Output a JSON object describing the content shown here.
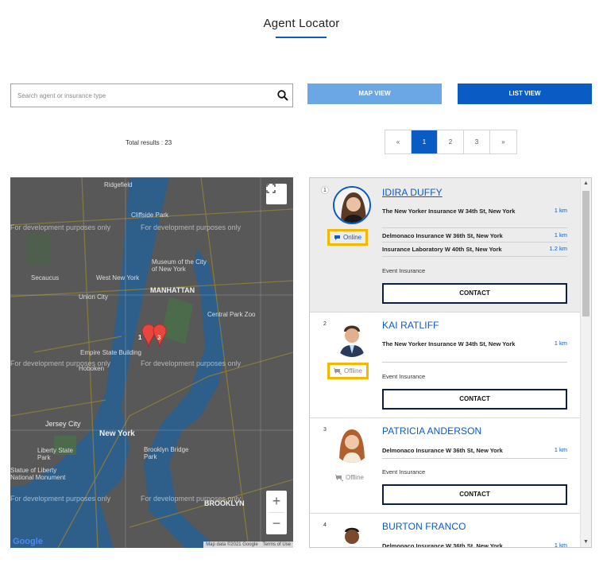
{
  "page": {
    "title": "Agent Locator"
  },
  "search": {
    "placeholder": "Search agent or insurance type"
  },
  "view_buttons": {
    "map": "MAP VIEW",
    "list": "LIST VIEW"
  },
  "results": {
    "total_label": "Total results : 23"
  },
  "pagination": {
    "prev": "«",
    "pages": [
      "1",
      "2",
      "3"
    ],
    "next": "»",
    "current": "1"
  },
  "map": {
    "watermark": "For development purposes only",
    "places": [
      "Ridgefield",
      "Cliffside Park",
      "Secaucus",
      "West New York",
      "Union City",
      "Museum of the City of New York",
      "MANHATTAN",
      "Central Park Zoo",
      "Empire State Building",
      "Hoboken",
      "Jersey City",
      "New York",
      "Liberty State Park",
      "Statue of Liberty National Monument",
      "Brooklyn Bridge Park",
      "BROOKLYN"
    ],
    "markers": [
      "1",
      "3"
    ],
    "google": "Google",
    "attribution": {
      "data": "Map data ©2021 Google",
      "terms": "Terms of Use"
    },
    "zoom_in": "+",
    "zoom_out": "−"
  },
  "agents": [
    {
      "number": "1",
      "name": "IDIRA DUFFY",
      "status": "Online",
      "offices": [
        {
          "name": "The New Yorker Insurance W 34th St, New York",
          "distance": "1 km"
        },
        {
          "name": "Delmonaco Insurance W 36th St, New York",
          "distance": "1 km"
        },
        {
          "name": "Insurance Laboratory W 40th St, New York",
          "distance": "1.2 km"
        }
      ],
      "insurance_type": "Event Insurance",
      "contact": "CONTACT"
    },
    {
      "number": "2",
      "name": "KAI RATLIFF",
      "status": "Offline",
      "offices": [
        {
          "name": "The New Yorker Insurance W 34th St, New York",
          "distance": "1 km"
        }
      ],
      "insurance_type": "Event Insurance",
      "contact": "CONTACT"
    },
    {
      "number": "3",
      "name": "PATRICIA ANDERSON",
      "status": "Offline",
      "offices": [
        {
          "name": "Delmonaco Insurance W 36th St, New York",
          "distance": "1 km"
        }
      ],
      "insurance_type": "Event Insurance",
      "contact": "CONTACT"
    },
    {
      "number": "4",
      "name": "BURTON FRANCO",
      "status": "",
      "offices": [
        {
          "name": "Delmonaco Insurance W 36th St, New York",
          "distance": "1 km"
        }
      ],
      "insurance_type": "",
      "contact": ""
    }
  ],
  "colors": {
    "primary": "#0a5bc4",
    "map_button": "#6aa7e4",
    "highlight": "#f5b800",
    "contact_border": "#0c1f44"
  }
}
